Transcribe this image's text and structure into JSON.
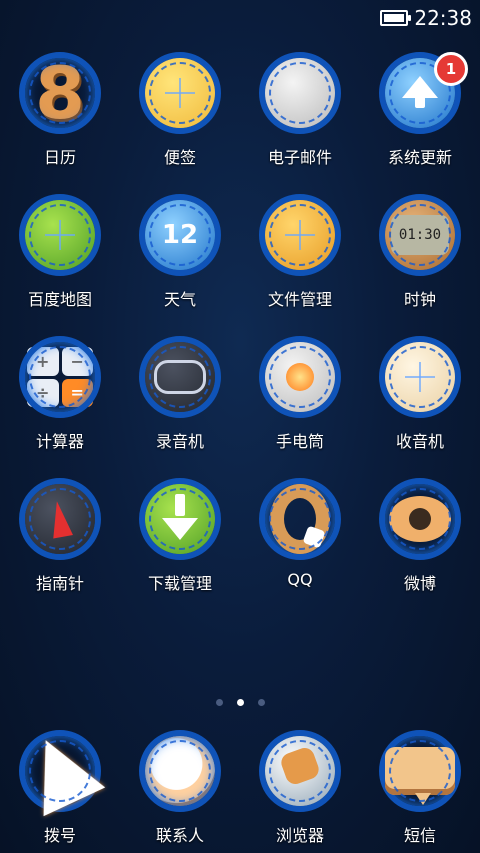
{
  "status": {
    "time": "22:38"
  },
  "apps": [
    {
      "label": "日历",
      "icon": "calendar-icon"
    },
    {
      "label": "便签",
      "icon": "notes-icon"
    },
    {
      "label": "电子邮件",
      "icon": "email-icon"
    },
    {
      "label": "系统更新",
      "icon": "system-update-icon",
      "badge": "1"
    },
    {
      "label": "百度地图",
      "icon": "baidu-map-icon"
    },
    {
      "label": "天气",
      "icon": "weather-icon",
      "glyph": "12"
    },
    {
      "label": "文件管理",
      "icon": "file-manager-icon"
    },
    {
      "label": "时钟",
      "icon": "clock-icon",
      "glyph": "01:30"
    },
    {
      "label": "计算器",
      "icon": "calculator-icon"
    },
    {
      "label": "录音机",
      "icon": "recorder-icon"
    },
    {
      "label": "手电筒",
      "icon": "flashlight-icon"
    },
    {
      "label": "收音机",
      "icon": "radio-icon"
    },
    {
      "label": "指南针",
      "icon": "compass-icon"
    },
    {
      "label": "下载管理",
      "icon": "download-manager-icon"
    },
    {
      "label": "QQ",
      "icon": "qq-icon"
    },
    {
      "label": "微博",
      "icon": "weibo-icon"
    }
  ],
  "pager": {
    "count": 3,
    "active_index": 1
  },
  "dock": [
    {
      "label": "拨号",
      "icon": "phone-icon"
    },
    {
      "label": "联系人",
      "icon": "contacts-icon"
    },
    {
      "label": "浏览器",
      "icon": "browser-icon"
    },
    {
      "label": "短信",
      "icon": "messages-icon"
    }
  ]
}
